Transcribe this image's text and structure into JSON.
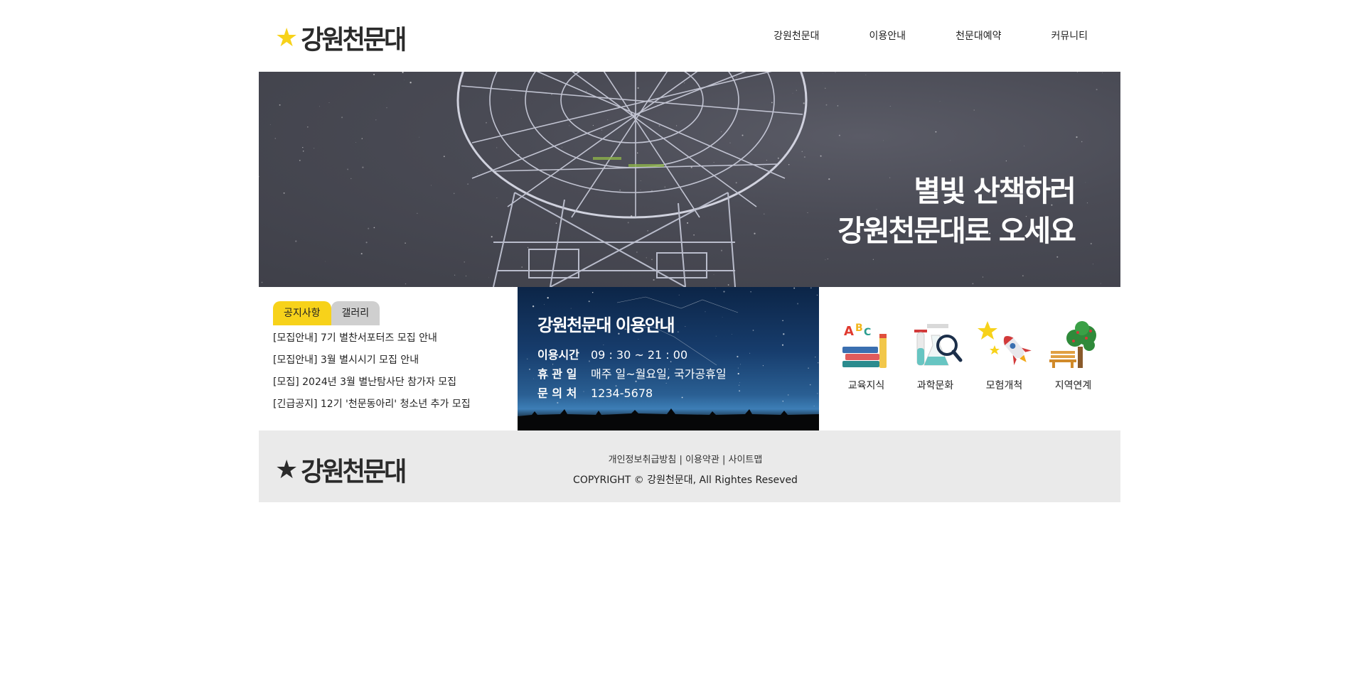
{
  "header": {
    "logo_star": "★",
    "logo_text": "강원천문대",
    "nav": [
      "강원천문대",
      "이용안내",
      "천문대예약",
      "커뮤니티"
    ]
  },
  "banner": {
    "slogan_line1": "별빛 산책하러",
    "slogan_line2": "강원천문대로 오세요"
  },
  "notice": {
    "tabs": [
      "공지사항",
      "갤러리"
    ],
    "posts": [
      "[모집안내] 7기 별찬서포터즈 모집 안내",
      "[모집안내] 3월 별시시기 모집 안내",
      "[모집] 2024년 3월 별난탐사단 참가자 모집",
      "[긴급공지] 12기 '천문동아리' 청소년 추가 모집"
    ]
  },
  "info": {
    "title": "강원천문대 이용안내",
    "rows": [
      {
        "label": "이용시간",
        "value": "09 : 30 ~ 21 : 00"
      },
      {
        "label": "휴 관 일",
        "value": "매주 일~월요일, 국가공휴일"
      },
      {
        "label": "문 의 처",
        "value": "1234-5678"
      }
    ]
  },
  "categories": [
    {
      "label": "교육지식",
      "icon": "books-icon"
    },
    {
      "label": "과학문화",
      "icon": "science-icon"
    },
    {
      "label": "모험개척",
      "icon": "rocket-icon"
    },
    {
      "label": "지역연계",
      "icon": "tree-bench-icon"
    }
  ],
  "footer": {
    "logo_star": "★",
    "logo_text": "강원천문대",
    "links": [
      "개인정보취급방침",
      "이용약관",
      "사이트맵"
    ],
    "separator": "|",
    "copyright": "COPYRIGHT © 강원천문대, All Rightes Reseved"
  },
  "colors": {
    "accent_yellow": "#f7d21a",
    "tab_inactive": "#cfcfcf",
    "footer_bg": "#eaeaea",
    "banner_bg": "#4a4b55"
  }
}
